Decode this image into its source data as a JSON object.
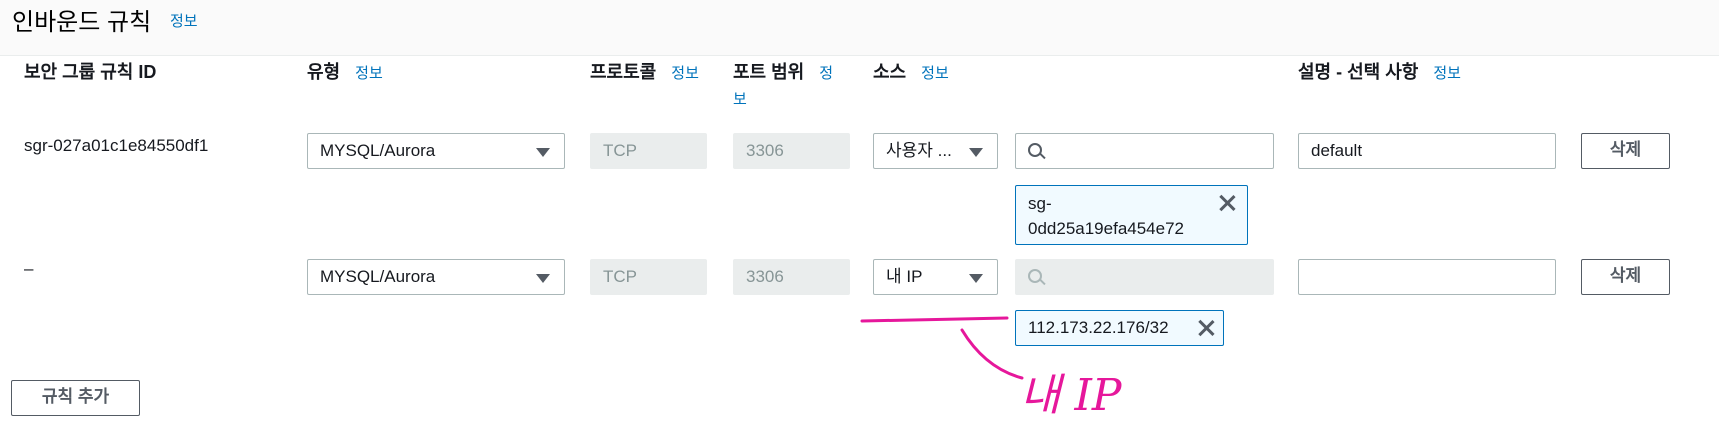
{
  "header": {
    "title": "인바운드 규칙",
    "info": "정보"
  },
  "columns": {
    "rule_id": "보안 그룹 규칙 ID",
    "type": "유형",
    "type_info": "정보",
    "protocol": "프로토콜",
    "protocol_info": "정보",
    "port_range": "포트 범위",
    "port_info": "정보",
    "source": "소스",
    "source_info": "정보",
    "description": "설명 - 선택 사항",
    "description_info": "정보"
  },
  "rules": [
    {
      "id": "sgr-027a01c1e84550df1",
      "type": "MYSQL/Aurora",
      "protocol": "TCP",
      "port": "3306",
      "source_type": "사용자 ...",
      "search_value": "",
      "token_line1": "sg-",
      "token_line2": "0dd25a19efa454e72",
      "description": "default",
      "delete": "삭제"
    },
    {
      "id": "–",
      "type": "MYSQL/Aurora",
      "protocol": "TCP",
      "port": "3306",
      "source_type": "내 IP",
      "search_value": "",
      "token": "112.173.22.176/32",
      "description": "",
      "delete": "삭제"
    }
  ],
  "add_rule": "규칙 추가",
  "annotation": {
    "text": "내 IP",
    "color": "#e6179b"
  },
  "colors": {
    "link": "#0073bb",
    "token_bg": "#f1faff",
    "disabled_bg": "#eaeded"
  },
  "icons": [
    "search-icon",
    "caret-down-icon",
    "close-icon"
  ]
}
